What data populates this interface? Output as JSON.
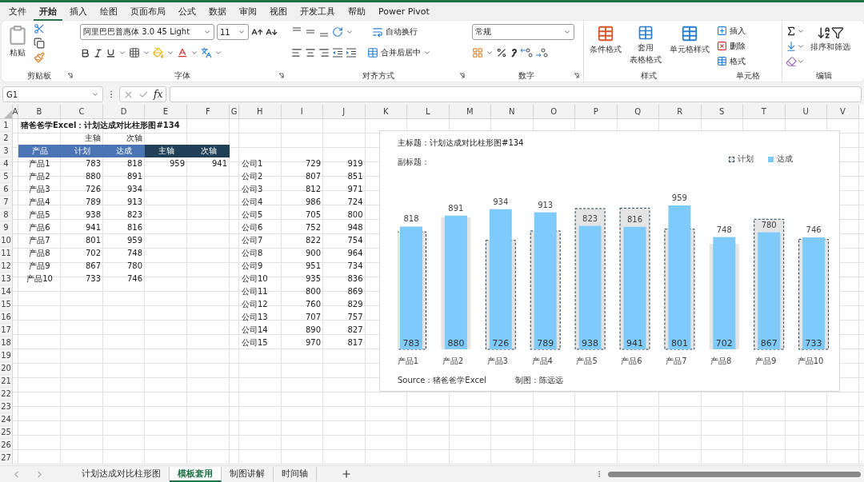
{
  "ribbon": {
    "tabs": [
      {
        "label": "文件",
        "selected": false
      },
      {
        "label": "开始",
        "selected": true
      },
      {
        "label": "插入",
        "selected": false
      },
      {
        "label": "绘图",
        "selected": false
      },
      {
        "label": "页面布局",
        "selected": false
      },
      {
        "label": "公式",
        "selected": false
      },
      {
        "label": "数据",
        "selected": false
      },
      {
        "label": "审阅",
        "selected": false
      },
      {
        "label": "视图",
        "selected": false
      },
      {
        "label": "开发工具",
        "selected": false
      },
      {
        "label": "帮助",
        "selected": false
      },
      {
        "label": "Power Pivot",
        "selected": false
      }
    ],
    "clipboard": {
      "paste": "粘贴",
      "label": "剪贴板"
    },
    "font": {
      "name": "阿里巴巴普惠体 3.0 45 Light",
      "size": "11",
      "label": "字体"
    },
    "alignment": {
      "wrap": "自动换行",
      "merge": "合并后居中",
      "label": "对齐方式"
    },
    "number": {
      "format": "常规",
      "label": "数字"
    },
    "styles": {
      "conditional": "条件格式",
      "table": [
        "套用",
        "表格格式"
      ],
      "cell_style": "单元格样式",
      "label": "样式"
    },
    "cells": {
      "insert": "插入",
      "delete": "删除",
      "format": "格式",
      "label": "单元格"
    },
    "editing": {
      "sort": "排序和筛选",
      "label": "编辑"
    }
  },
  "formula_bar": {
    "name_box": "G1",
    "function_label": "fx"
  },
  "sheet": {
    "columns": [
      "A",
      "B",
      "C",
      "D",
      "E",
      "F",
      "G",
      "H",
      "I",
      "J",
      "K",
      "L",
      "M",
      "N",
      "O",
      "P",
      "Q",
      "R",
      "S",
      "T",
      "U",
      "V"
    ],
    "rows": [
      {
        "header": "1",
        "kind": "title",
        "cells": [
          null,
          "猪爸爸学Excel：计划达成对比柱形图#134"
        ]
      },
      {
        "header": "2",
        "kind": "data",
        "cells": [
          null,
          null,
          "主轴",
          "次轴"
        ]
      },
      {
        "header": "3",
        "kind": "header",
        "cells": [
          null,
          {
            "text": "产品",
            "color": "#4b74b4"
          },
          {
            "text": "计划",
            "color": "#4b74b4"
          },
          {
            "text": "达成",
            "color": "#4b74b4"
          },
          {
            "text": "主轴",
            "color": "#1f4057"
          },
          {
            "text": "次轴",
            "color": "#1f4057"
          }
        ]
      },
      {
        "header": "4",
        "kind": "data",
        "cells": [
          null,
          "产品1",
          "783",
          "818",
          "959",
          "941",
          null,
          "公司1",
          "729",
          "919"
        ]
      },
      {
        "header": "5",
        "kind": "data",
        "cells": [
          null,
          "产品2",
          "880",
          "891",
          null,
          null,
          null,
          "公司2",
          "807",
          "851"
        ]
      },
      {
        "header": "6",
        "kind": "data",
        "cells": [
          null,
          "产品3",
          "726",
          "934",
          null,
          null,
          null,
          "公司3",
          "812",
          "971"
        ]
      },
      {
        "header": "7",
        "kind": "data",
        "cells": [
          null,
          "产品4",
          "789",
          "913",
          null,
          null,
          null,
          "公司4",
          "986",
          "724"
        ]
      },
      {
        "header": "8",
        "kind": "data",
        "cells": [
          null,
          "产品5",
          "938",
          "823",
          null,
          null,
          null,
          "公司5",
          "705",
          "800"
        ]
      },
      {
        "header": "9",
        "kind": "data",
        "cells": [
          null,
          "产品6",
          "941",
          "816",
          null,
          null,
          null,
          "公司6",
          "752",
          "948"
        ]
      },
      {
        "header": "10",
        "kind": "data",
        "cells": [
          null,
          "产品7",
          "801",
          "959",
          null,
          null,
          null,
          "公司7",
          "822",
          "754"
        ]
      },
      {
        "header": "11",
        "kind": "data",
        "cells": [
          null,
          "产品8",
          "702",
          "748",
          null,
          null,
          null,
          "公司8",
          "900",
          "964"
        ]
      },
      {
        "header": "12",
        "kind": "data",
        "cells": [
          null,
          "产品9",
          "867",
          "780",
          null,
          null,
          null,
          "公司9",
          "951",
          "734"
        ]
      },
      {
        "header": "13",
        "kind": "data",
        "cells": [
          null,
          "产品10",
          "733",
          "746",
          null,
          null,
          null,
          "公司10",
          "935",
          "836"
        ]
      },
      {
        "header": "14",
        "kind": "data",
        "cells": [
          null,
          null,
          null,
          null,
          null,
          null,
          null,
          "公司11",
          "800",
          "869"
        ]
      },
      {
        "header": "15",
        "kind": "data",
        "cells": [
          null,
          null,
          null,
          null,
          null,
          null,
          null,
          "公司12",
          "760",
          "829"
        ]
      },
      {
        "header": "16",
        "kind": "data",
        "cells": [
          null,
          null,
          null,
          null,
          null,
          null,
          null,
          "公司13",
          "707",
          "757"
        ]
      },
      {
        "header": "17",
        "kind": "data",
        "cells": [
          null,
          null,
          null,
          null,
          null,
          null,
          null,
          "公司14",
          "890",
          "827"
        ]
      },
      {
        "header": "18",
        "kind": "data",
        "cells": [
          null,
          null,
          null,
          null,
          null,
          null,
          null,
          "公司15",
          "970",
          "817"
        ]
      },
      {
        "header": "19"
      },
      {
        "header": "20"
      },
      {
        "header": "21"
      },
      {
        "header": "22"
      },
      {
        "header": "23"
      },
      {
        "header": "24"
      },
      {
        "header": "25"
      },
      {
        "header": "26"
      },
      {
        "header": "27"
      }
    ]
  },
  "chart": {
    "subtitle": "副标题：",
    "source": "Source：猪爸爸学Excel",
    "credit": "制图：陈远远",
    "outlined": [
      true,
      false,
      true,
      true,
      true,
      true,
      true,
      false,
      true,
      true
    ],
    "chart_data": {
      "type": "bar",
      "title": "主标题：计划达成对比柱形图#134",
      "categories": [
        "产品1",
        "产品2",
        "产品3",
        "产品4",
        "产品5",
        "产品6",
        "产品7",
        "产品8",
        "产品9",
        "产品10"
      ],
      "series": [
        {
          "name": "计划",
          "color": "#e4e4e4",
          "values": [
            783,
            880,
            726,
            789,
            938,
            941,
            801,
            702,
            867,
            733
          ]
        },
        {
          "name": "达成",
          "color": "#7ecbfb",
          "values": [
            818,
            891,
            934,
            913,
            823,
            816,
            959,
            748,
            780,
            746
          ]
        }
      ],
      "stacked": false,
      "data_labels": true
    }
  },
  "sheet_tabs": [
    {
      "label": "计划达成对比柱形图",
      "selected": false
    },
    {
      "label": "模板套用",
      "selected": true
    },
    {
      "label": "制图讲解",
      "selected": false
    },
    {
      "label": "时间轴",
      "selected": false
    }
  ]
}
